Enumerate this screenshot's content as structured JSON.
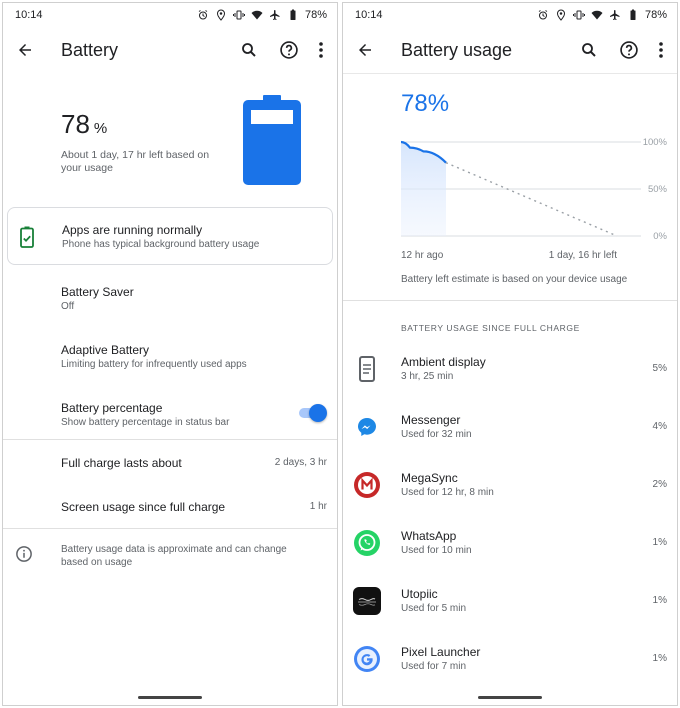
{
  "status": {
    "time": "10:14",
    "battery": "78%"
  },
  "left": {
    "title": "Battery",
    "percent": "78",
    "percent_unit": "%",
    "estimate": "About 1 day, 17 hr left based on your usage",
    "battery_fill": 0.78,
    "card": {
      "title": "Apps are running normally",
      "subtitle": "Phone has typical background battery usage"
    },
    "settings": [
      {
        "title": "Battery Saver",
        "subtitle": "Off"
      },
      {
        "title": "Adaptive Battery",
        "subtitle": "Limiting battery for infrequently used apps"
      },
      {
        "title": "Battery percentage",
        "subtitle": "Show battery percentage in status bar",
        "toggle_on": true
      }
    ],
    "stats": [
      {
        "label": "Full charge lasts about",
        "value": "2 days, 3 hr"
      },
      {
        "label": "Screen usage since full charge",
        "value": "1 hr"
      }
    ],
    "info": "Battery usage data is approximate and can change based on usage"
  },
  "right": {
    "title": "Battery usage",
    "percent": "78%",
    "estimate_note": "Battery left estimate is based on your device usage",
    "section_header": "BATTERY USAGE SINCE FULL CHARGE",
    "accent": "#1a73e8",
    "chart_data": {
      "type": "line",
      "y_ticks": [
        "100%",
        "50%",
        "0%"
      ],
      "x_labels": [
        "12 hr ago",
        "1 day, 16 hr left"
      ],
      "ylim": [
        0,
        100
      ],
      "series": [
        {
          "values": [
            [
              0,
              100
            ],
            [
              2,
              94
            ],
            [
              5,
              90
            ],
            [
              10,
              78
            ]
          ]
        },
        {
          "values": [
            [
              10,
              78
            ],
            [
              48,
              0
            ]
          ]
        }
      ]
    },
    "apps": [
      {
        "name": "Ambient display",
        "detail": "3 hr, 25 min",
        "percent": "5%",
        "icon": "ambient-display-icon"
      },
      {
        "name": "Messenger",
        "detail": "Used for 32 min",
        "percent": "4%",
        "icon": "messenger-icon"
      },
      {
        "name": "MegaSync",
        "detail": "Used for 12 hr, 8 min",
        "percent": "2%",
        "icon": "megasync-icon"
      },
      {
        "name": "WhatsApp",
        "detail": "Used for 10 min",
        "percent": "1%",
        "icon": "whatsapp-icon"
      },
      {
        "name": "Utopiic",
        "detail": "Used for 5 min",
        "percent": "1%",
        "icon": "utopiic-icon"
      },
      {
        "name": "Pixel Launcher",
        "detail": "Used for 7 min",
        "percent": "1%",
        "icon": "pixel-launcher-icon"
      }
    ]
  }
}
